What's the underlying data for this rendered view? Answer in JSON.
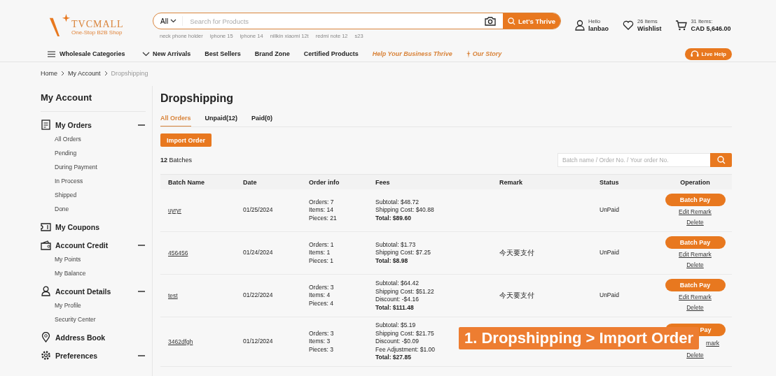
{
  "header": {
    "logo": {
      "name": "TVCMALL",
      "tagline": "One-Stop B2B Shop"
    },
    "search": {
      "category": "All",
      "placeholder": "Search for Products",
      "button": "Let's Thrive"
    },
    "suggestions": [
      "neck phone holder",
      "iphone 15",
      "iphone 14",
      "nillkin xiaomi 12t",
      "redmi note 12",
      "s23"
    ],
    "account": {
      "greeting": "Hello",
      "user": "lanbao"
    },
    "wishlist": {
      "count": "26 Items",
      "label": "Wishlist"
    },
    "cart": {
      "count": "31 Items:",
      "total": "CAD 5,646.00"
    }
  },
  "nav": {
    "categories": "Wholesale Categories",
    "links": [
      {
        "label": "New Arrivals",
        "kind": "plain"
      },
      {
        "label": "Best Sellers",
        "kind": "plain"
      },
      {
        "label": "Brand Zone",
        "kind": "plain"
      },
      {
        "label": "Certified Products",
        "kind": "plain"
      },
      {
        "label": "Help Your Business Thrive",
        "kind": "promo"
      },
      {
        "label": "Our Story",
        "kind": "story"
      }
    ],
    "live_help": "Live Help"
  },
  "breadcrumb": [
    {
      "label": "Home",
      "current": false
    },
    {
      "label": "My Account",
      "current": false
    },
    {
      "label": "Dropshipping",
      "current": true
    }
  ],
  "sidebar": {
    "title": "My Account",
    "sections": [
      {
        "label": "My Orders",
        "kind": "group",
        "expanded": true,
        "children": [
          "All Orders",
          "Pending",
          "During Payment",
          "In Process",
          "Shipped",
          "Done"
        ]
      },
      {
        "label": "My Coupons",
        "kind": "link"
      },
      {
        "label": "Account Credit",
        "kind": "group",
        "expanded": true,
        "children": [
          "My Points",
          "My Balance"
        ]
      },
      {
        "label": "Account Details",
        "kind": "group",
        "expanded": true,
        "children": [
          "My Profile",
          "Security Center"
        ]
      },
      {
        "label": "Address Book",
        "kind": "link"
      },
      {
        "label": "Preferences",
        "kind": "group",
        "expanded": true
      }
    ]
  },
  "main": {
    "title": "Dropshipping",
    "tabs": [
      {
        "label": "All Orders",
        "selected": true
      },
      {
        "label": "Unpaid(12)",
        "selected": false
      },
      {
        "label": "Paid(0)",
        "selected": false
      }
    ],
    "import_button": "Import Order",
    "batch_count": "12",
    "batch_label": "Batches",
    "search_placeholder": "Batch name / Order No. / Your order No.",
    "columns": [
      "Batch Name",
      "Date",
      "Order info",
      "Fees",
      "Remark",
      "Status",
      "Operation"
    ],
    "rows": [
      {
        "name": "uyryr",
        "date": "01/25/2024",
        "order_info": [
          "Orders: 7",
          "Items: 14",
          "Pieces: 21"
        ],
        "fees": [
          {
            "text": "Subtotal: $48.72",
            "kind": "line"
          },
          {
            "text": "Shipping Cost: $40.88",
            "kind": "line"
          },
          {
            "text": "Total: $89.60",
            "kind": "total"
          }
        ],
        "status": "UnPaid",
        "ops": {
          "pay": "Batch Pay",
          "edit": "Edit Remark",
          "delete": "Delete"
        },
        "covered": false
      },
      {
        "name": "456456",
        "date": "01/24/2024",
        "order_info": [
          "Orders: 1",
          "Items: 1",
          "Pieces: 1"
        ],
        "fees": [
          {
            "text": "Subtotal: $1.73",
            "kind": "line"
          },
          {
            "text": "Shipping Cost: $7.25",
            "kind": "line"
          },
          {
            "text": "Total: $8.98",
            "kind": "total"
          }
        ],
        "remark": "今天要支付",
        "status": "UnPaid",
        "ops": {
          "pay": "Batch Pay",
          "edit": "Edit Remark",
          "delete": "Delete"
        },
        "covered": false
      },
      {
        "name": "test",
        "date": "01/22/2024",
        "order_info": [
          "Orders: 3",
          "Items: 4",
          "Pieces: 4"
        ],
        "fees": [
          {
            "text": "Subtotal: $64.42",
            "kind": "line"
          },
          {
            "text": "Shipping Cost: $51.22",
            "kind": "line"
          },
          {
            "text": "Discount: -$4.16",
            "kind": "line"
          },
          {
            "text": "Total: $111.48",
            "kind": "total"
          }
        ],
        "remark": "今天要支付",
        "status": "UnPaid",
        "ops": {
          "pay": "Batch Pay",
          "edit": "Edit Remark",
          "delete": "Delete"
        },
        "covered": false
      },
      {
        "name": "3462dfgh",
        "date": "01/12/2024",
        "order_info": [
          "Orders: 3",
          "Items: 3",
          "Pieces: 3"
        ],
        "fees": [
          {
            "text": "Subtotal: $5.19",
            "kind": "line"
          },
          {
            "text": "Shipping Cost: $21.75",
            "kind": "line"
          },
          {
            "text": "Discount: -$0.09",
            "kind": "line"
          },
          {
            "text": "Fee Adjustment: $1.00",
            "kind": "line"
          },
          {
            "text": "Total: $27.85",
            "kind": "total"
          }
        ],
        "ops": {
          "pay": "Pay",
          "edit": "mark",
          "delete": "Delete"
        },
        "covered": true
      }
    ]
  },
  "caption": "1. Dropshipping > Import Order"
}
